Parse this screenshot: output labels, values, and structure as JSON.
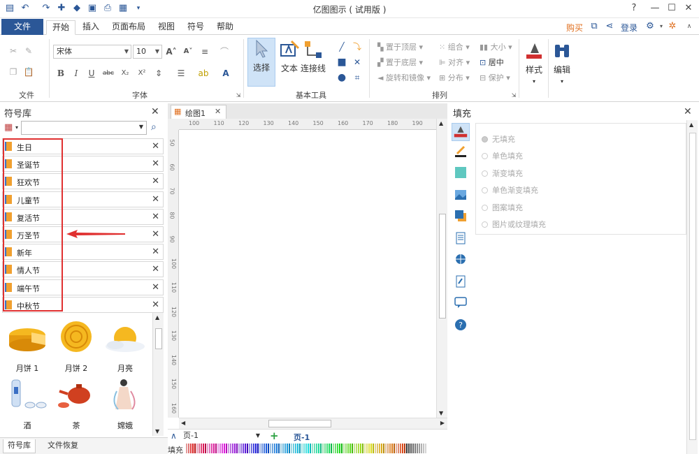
{
  "app": {
    "title": "亿图图示 ( 试用版 )"
  },
  "menu": {
    "file": "文件",
    "tabs": [
      "开始",
      "插入",
      "页面布局",
      "视图",
      "符号",
      "帮助"
    ],
    "buy": "购买",
    "login": "登录"
  },
  "ribbon": {
    "groups": {
      "file": "文件",
      "font": "字体",
      "basic_tools": "基本工具",
      "arrange": "排列"
    },
    "font_name": "宋体",
    "font_size": "10",
    "tools": {
      "select": "选择",
      "text": "文本",
      "connector": "连接线",
      "style": "样式",
      "edit": "编辑"
    },
    "arrange": {
      "bring_front": "置于顶层",
      "send_back": "置于底层",
      "rotate_mirror": "旋转和镜像",
      "group": "组合",
      "align": "对齐",
      "distribute": "分布",
      "size": "大小",
      "center": "居中",
      "protect": "保护"
    }
  },
  "symbol_library": {
    "title": "符号库",
    "search_placeholder": "",
    "categories": [
      "生日",
      "圣诞节",
      "狂欢节",
      "儿童节",
      "复活节",
      "万圣节",
      "新年",
      "情人节",
      "端午节",
      "中秋节"
    ],
    "shapes": [
      "月饼 1",
      "月饼 2",
      "月亮",
      "酒",
      "茶",
      "嫦娥"
    ],
    "bottom_tabs": [
      "符号库",
      "文件恢复"
    ]
  },
  "canvas": {
    "doc_tab": "绘图1",
    "ruler_h": [
      "100",
      "110",
      "120",
      "130",
      "140",
      "150",
      "160",
      "170",
      "180",
      "190"
    ],
    "ruler_v": [
      "50",
      "60",
      "70",
      "80",
      "90",
      "100",
      "110",
      "120",
      "130",
      "140",
      "150",
      "160"
    ],
    "page_select": "页-1",
    "page_tab": "页-1",
    "fill_label": "填充"
  },
  "fill_panel": {
    "title": "填充",
    "options": [
      "无填充",
      "单色填充",
      "渐变填充",
      "单色渐变填充",
      "图案填充",
      "图片或纹理填充"
    ]
  },
  "colors": {
    "accent": "#2b5797",
    "highlight": "#e03030",
    "buy": "#e07020"
  }
}
